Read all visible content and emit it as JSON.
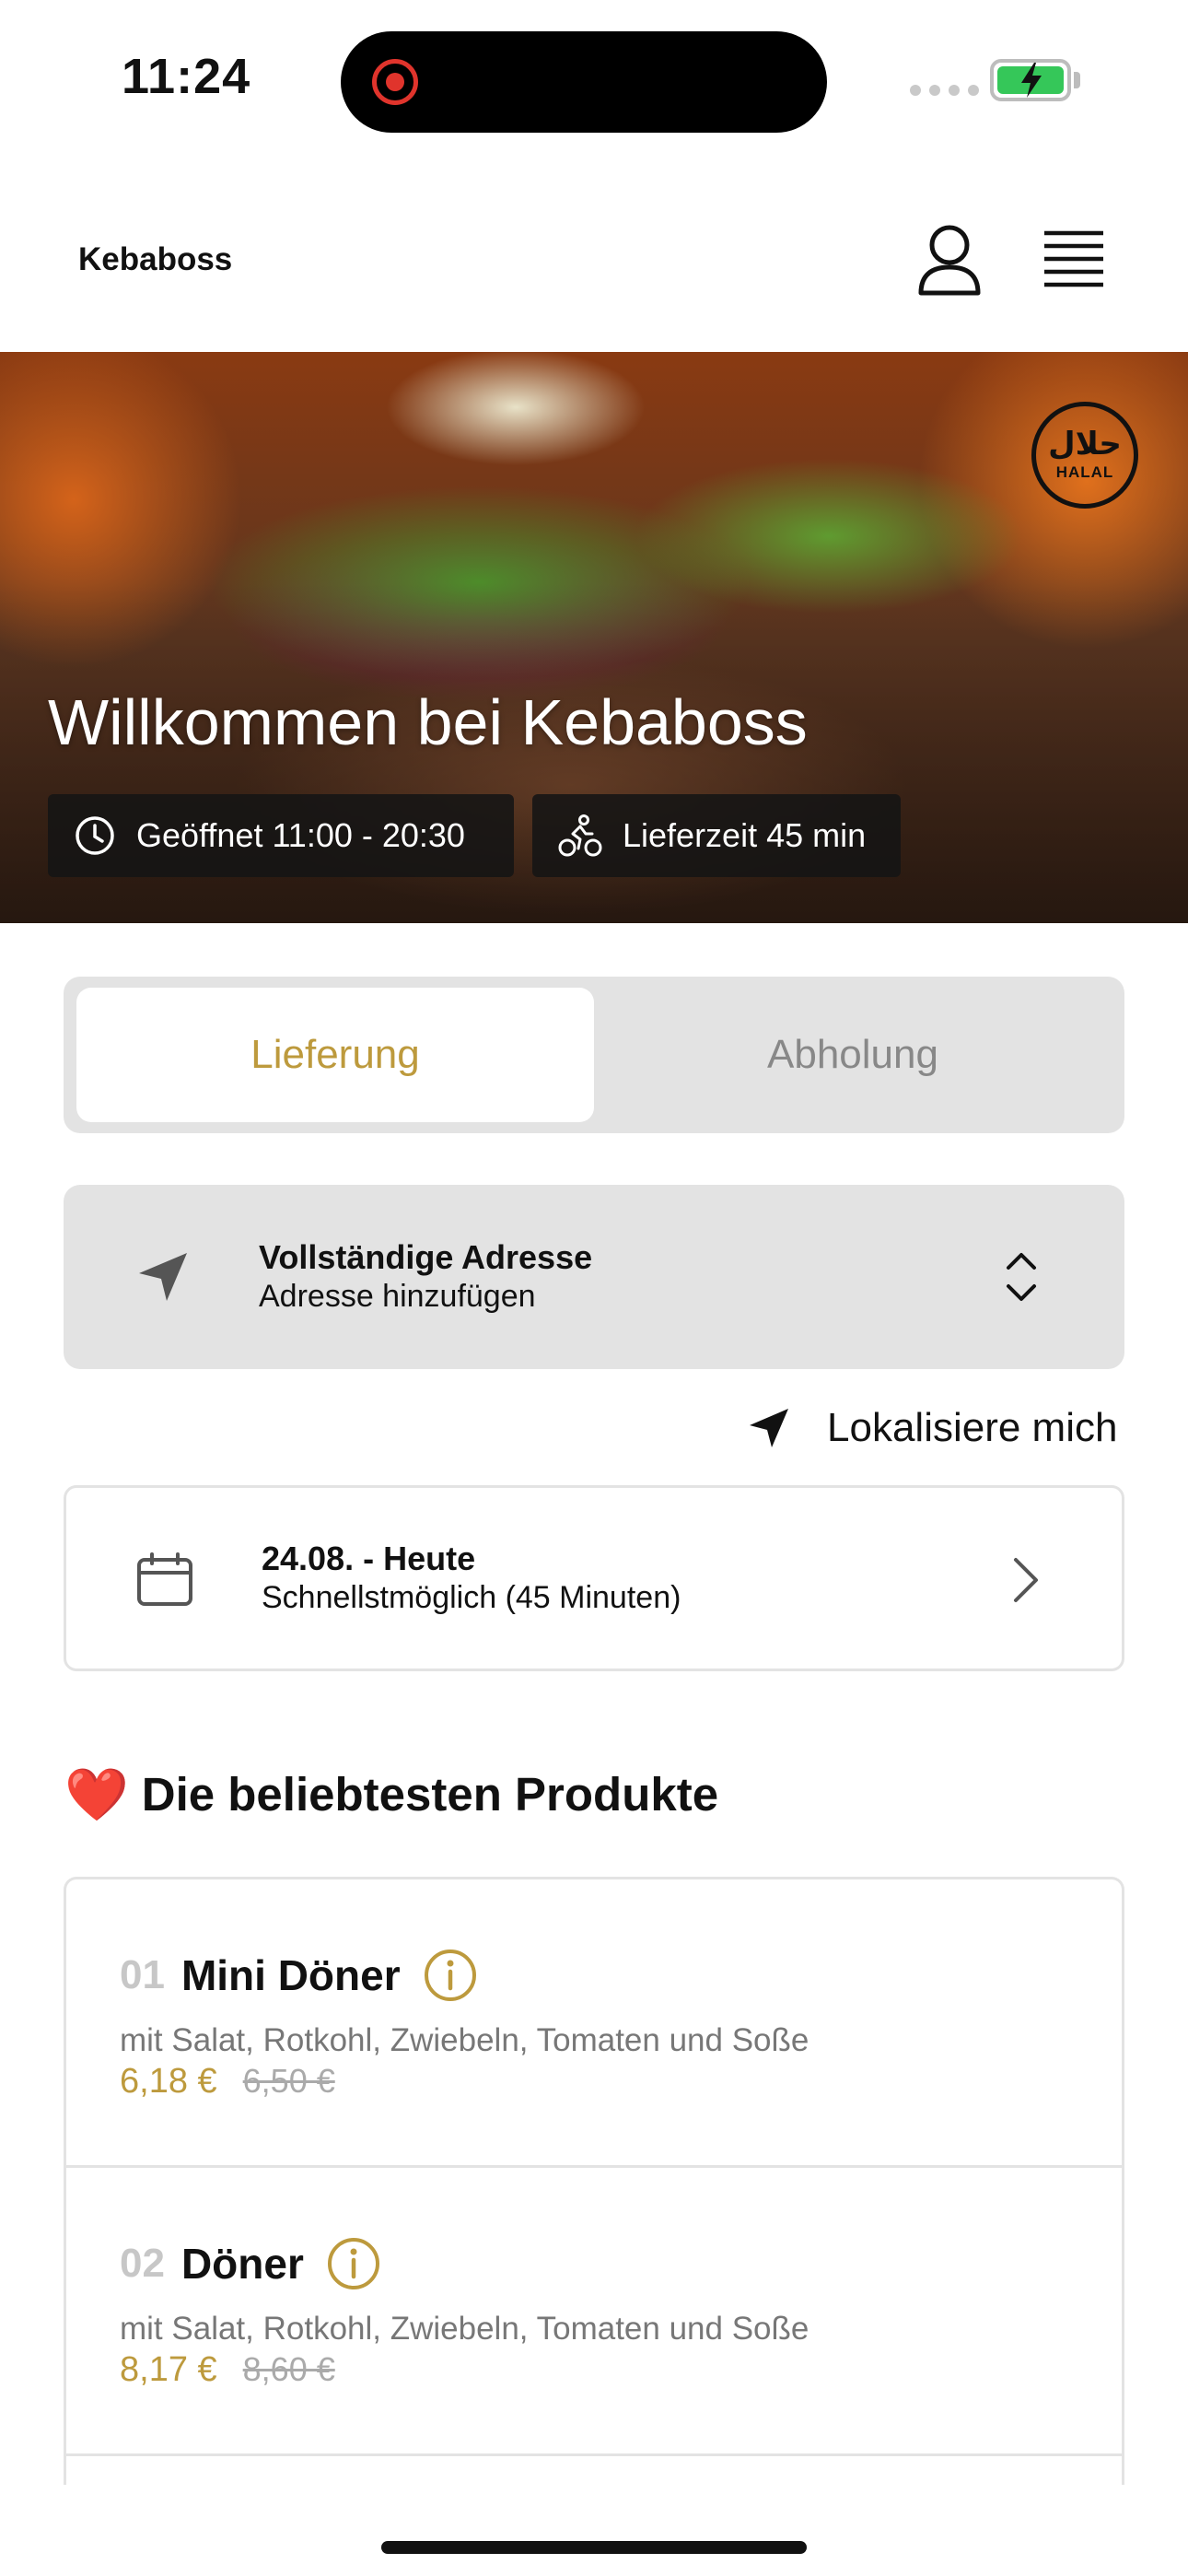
{
  "status_bar": {
    "time": "11:24"
  },
  "header": {
    "brand": "Kebaboss"
  },
  "hero": {
    "badge_arabic": "حلال",
    "badge_label": "HALAL",
    "title": "Willkommen bei Kebaboss",
    "opening_hours": "Geöffnet 11:00 - 20:30",
    "delivery_time": "Lieferzeit 45 min"
  },
  "mode_toggle": {
    "options": [
      {
        "label": "Lieferung",
        "active": true
      },
      {
        "label": "Abholung",
        "active": false
      }
    ]
  },
  "address": {
    "title": "Vollständige Adresse",
    "subtitle": "Adresse hinzufügen"
  },
  "locate": {
    "label": "Lokalisiere mich"
  },
  "schedule": {
    "title": "24.08. - Heute",
    "subtitle": "Schnellstmöglich (45 Minuten)"
  },
  "popular": {
    "emoji": "❤️",
    "heading": "Die beliebtesten Produkte",
    "items": [
      {
        "number": "01",
        "name": "Mini Döner",
        "description": "mit Salat, Rotkohl, Zwiebeln, Tomaten und Soße",
        "price": "6,18 €",
        "old_price": "6,50 €"
      },
      {
        "number": "02",
        "name": "Döner",
        "description": "mit Salat, Rotkohl, Zwiebeln, Tomaten und Soße",
        "price": "8,17 €",
        "old_price": "8,60 €"
      }
    ]
  },
  "colors": {
    "accent_gold": "#bd9a3d",
    "panel_gray": "#e3e3e3",
    "recording_red": "#e0342c",
    "battery_green": "#35c759"
  }
}
